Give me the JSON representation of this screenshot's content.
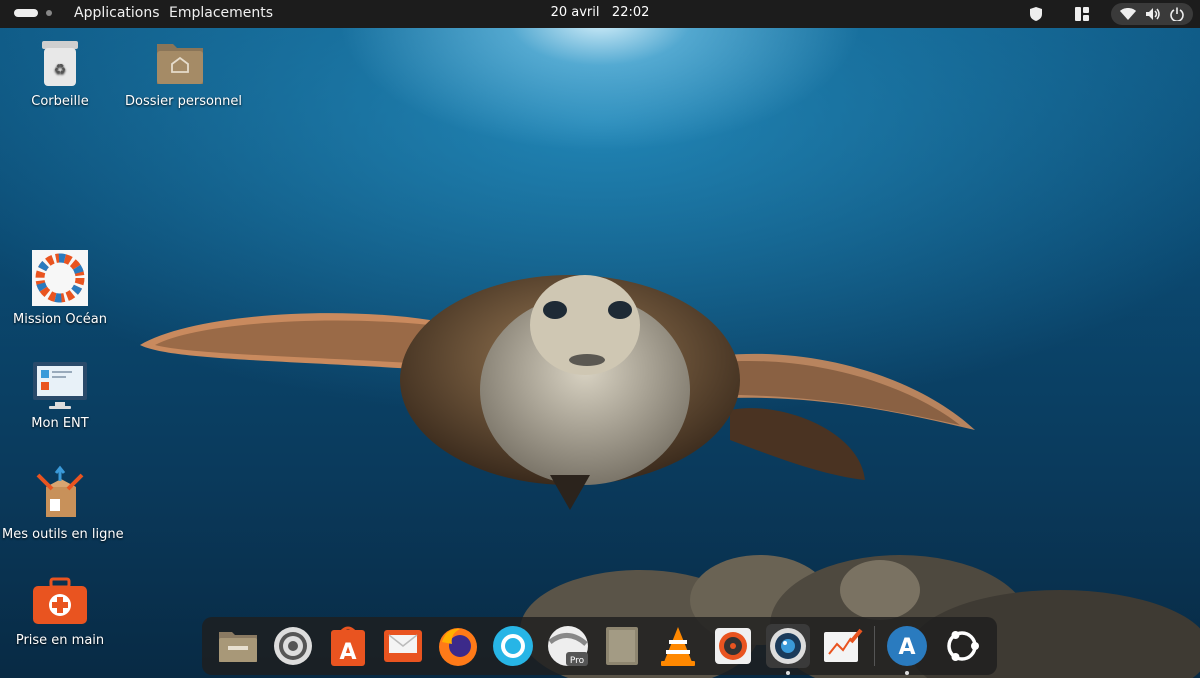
{
  "topbar": {
    "applications_label": "Applications",
    "places_label": "Emplacements",
    "date": "20 avril",
    "time": "22:02"
  },
  "desktop": {
    "icons": [
      {
        "label": "Corbeille",
        "icon": "trash-icon"
      },
      {
        "label": "Dossier personnel",
        "icon": "home-folder-icon"
      },
      {
        "label": "Mission Océan",
        "icon": "mission-ocean-icon"
      },
      {
        "label": "Mon ENT",
        "icon": "monitor-icon"
      },
      {
        "label": "Mes outils en ligne",
        "icon": "tools-box-icon"
      },
      {
        "label": "Prise en main",
        "icon": "first-aid-case-icon"
      }
    ]
  },
  "dock": {
    "apps": [
      {
        "name": "Fichiers",
        "icon": "files-icon"
      },
      {
        "name": "Paramètres",
        "icon": "settings-icon"
      },
      {
        "name": "Logithèque",
        "icon": "app-store-icon"
      },
      {
        "name": "Courrier",
        "icon": "mail-icon"
      },
      {
        "name": "Firefox",
        "icon": "firefox-icon"
      },
      {
        "name": "Navigateur",
        "icon": "browser-icon"
      },
      {
        "name": "Google Earth Pro",
        "icon": "earth-pro-icon"
      },
      {
        "name": "Éditeur",
        "icon": "notes-icon"
      },
      {
        "name": "VLC",
        "icon": "vlc-icon"
      },
      {
        "name": "Audio",
        "icon": "speaker-icon"
      },
      {
        "name": "Appareil photo",
        "icon": "camera-icon"
      },
      {
        "name": "Dessin",
        "icon": "drawing-icon"
      },
      {
        "name": "App Grid",
        "icon": "app-grid-icon"
      },
      {
        "name": "Ubuntu",
        "icon": "ubuntu-icon"
      }
    ]
  },
  "colors": {
    "topbar": "#1c1c1c",
    "accent_orange": "#e95420",
    "ocean_dark": "#0a3a5c"
  }
}
